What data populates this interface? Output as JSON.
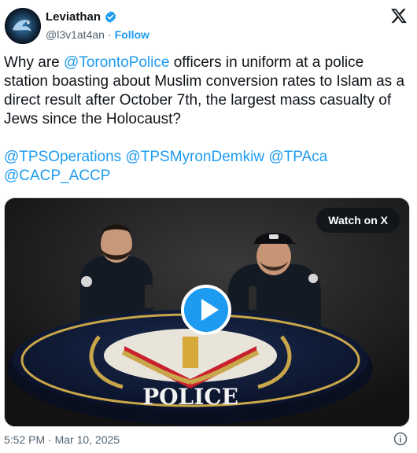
{
  "author": {
    "display_name": "Leviathan",
    "handle": "@l3v1at4an",
    "separator": "·",
    "follow_label": "Follow",
    "verified": true
  },
  "tweet": {
    "segments_line1": [
      {
        "text": "Why are ",
        "mention": false
      },
      {
        "text": "@TorontoPolice",
        "mention": true
      },
      {
        "text": " officers in uniform at a police station boasting about Muslim conversion rates to Islam as a direct result after October 7th, the largest mass casualty of Jews since the Holocaust?",
        "mention": false
      }
    ],
    "mentions": [
      "@TPSOperations",
      "@TPSMyronDemkiw",
      "@TPAca",
      "@CACP_ACCP"
    ]
  },
  "media": {
    "watch_label": "Watch on X",
    "table_text": "POLICE"
  },
  "footer": {
    "timestamp": "5:52 PM · Mar 10, 2025"
  },
  "icons": {
    "verified": "verified-badge-icon",
    "x_logo": "x-logo-icon",
    "play": "play-icon",
    "info": "info-icon"
  },
  "colors": {
    "accent": "#1d9bf0",
    "text": "#0f1419",
    "secondary": "#536471"
  }
}
